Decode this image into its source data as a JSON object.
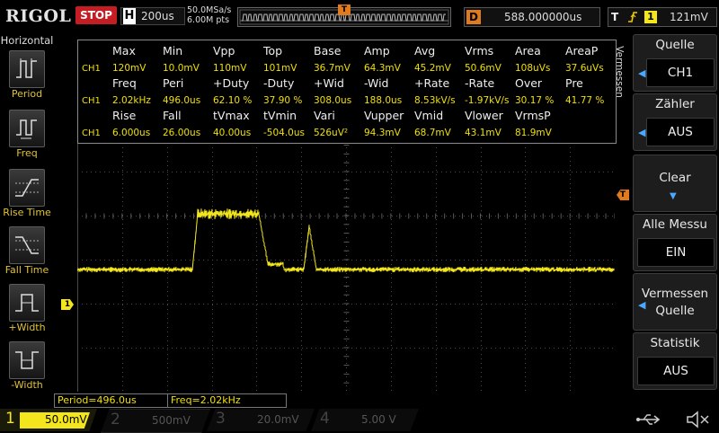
{
  "top": {
    "brand": "RIGOL",
    "run_status": "STOP",
    "timebase_label": "H",
    "timebase": "200us",
    "sample_rate": "50.0MSa/s",
    "memory_depth": "6.00M pts",
    "trigger_position_marker": "T",
    "delay_label": "D",
    "delay": "588.000000us",
    "trigger_label": "T",
    "trigger_slope_icon": "rising-edge-icon",
    "trigger_source": "1",
    "trigger_level": "121mV"
  },
  "left_panel": {
    "title": "Horizontal",
    "items": [
      {
        "label": "Period",
        "icon": "period-icon"
      },
      {
        "label": "Freq",
        "icon": "frequency-icon"
      },
      {
        "label": "Rise Time",
        "icon": "rise-time-icon"
      },
      {
        "label": "Fall Time",
        "icon": "fall-time-icon"
      },
      {
        "label": "+Width",
        "icon": "positive-width-icon"
      },
      {
        "label": "-Width",
        "icon": "negative-width-icon"
      }
    ]
  },
  "right_panel": {
    "tab_label": "Vermessen",
    "items": [
      {
        "title": "Quelle",
        "value": "CH1"
      },
      {
        "title": "Zähler",
        "value": "AUS"
      },
      {
        "title": "Clear",
        "value": ""
      },
      {
        "title": "Alle Messu",
        "value": "EIN"
      },
      {
        "title": "Vermessen",
        "title2": "Quelle",
        "value": ""
      },
      {
        "title": "Statistik",
        "value": "AUS"
      }
    ]
  },
  "measurements": {
    "channel": "CH1",
    "rows": [
      {
        "headers": [
          "Max",
          "Min",
          "Vpp",
          "Top",
          "Base",
          "Amp",
          "Avg",
          "Vrms",
          "Area",
          "AreaP"
        ],
        "values": [
          "120mV",
          "10.0mV",
          "110mV",
          "101mV",
          "36.7mV",
          "64.3mV",
          "45.2mV",
          "50.6mV",
          "108uVs",
          "37.6uVs"
        ]
      },
      {
        "headers": [
          "Freq",
          "Peri",
          "+Duty",
          "-Duty",
          "+Wid",
          "-Wid",
          "+Rate",
          "-Rate",
          "Over",
          "Pre"
        ],
        "values": [
          "2.02kHz",
          "496.0us",
          "62.10 %",
          "37.90 %",
          "308.0us",
          "188.0us",
          "8.53kV/s",
          "-1.97kV/s",
          "30.17 %",
          "41.77 %"
        ]
      },
      {
        "headers": [
          "Rise",
          "Fall",
          "tVmax",
          "tVmin",
          "Vari",
          "Vupper",
          "Vmid",
          "Vlower",
          "VrmsP",
          ""
        ],
        "values": [
          "6.000us",
          "26.00us",
          "40.00us",
          "-504.0us",
          "526uV²",
          "94.3mV",
          "68.7mV",
          "43.1mV",
          "81.9mV",
          ""
        ]
      }
    ]
  },
  "status": {
    "period": "Period=496.0us",
    "freq": "Freq=2.02kHz"
  },
  "channels": [
    {
      "num": "1",
      "scale": "50.0mV",
      "color": "#f3e61c",
      "active": true
    },
    {
      "num": "2",
      "scale": "500mV",
      "color": "#21c5e8",
      "active": false
    },
    {
      "num": "3",
      "scale": "20.0mV",
      "color": "#e14bb2",
      "active": false
    },
    {
      "num": "4",
      "scale": "5.00 V",
      "color": "#2b6ad9",
      "active": false
    }
  ],
  "markers": {
    "ch1_offset": "1",
    "trigger_level": "T"
  },
  "icons": {
    "usb": "usb-icon",
    "speaker": "speaker-muted-icon"
  },
  "colors": {
    "trace": "#f3e61c",
    "stop": "#c41e24",
    "trigger": "#e07a1e",
    "grid": "#4a4a4a"
  }
}
